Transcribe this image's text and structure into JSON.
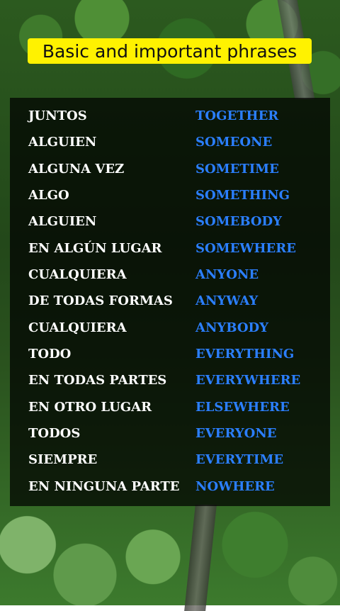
{
  "title": "Basic and important phrases",
  "colors": {
    "title_bg": "#fff200",
    "spanish_text": "#ffffff",
    "english_text": "#2b7fff"
  },
  "phrases": [
    {
      "es": "JUNTOS",
      "en": "TOGETHER"
    },
    {
      "es": "ALGUIEN",
      "en": "SOMEONE"
    },
    {
      "es": "ALGUNA VEZ",
      "en": "SOMETIME"
    },
    {
      "es": "ALGO",
      "en": "SOMETHING"
    },
    {
      "es": "ALGUIEN",
      "en": "SOMEBODY"
    },
    {
      "es": "EN ALGÚN LUGAR",
      "en": "SOMEWHERE"
    },
    {
      "es": "CUALQUIERA",
      "en": "ANYONE"
    },
    {
      "es": "DE TODAS FORMAS",
      "en": "ANYWAY"
    },
    {
      "es": "CUALQUIERA",
      "en": "ANYBODY"
    },
    {
      "es": "TODO",
      "en": "EVERYTHING"
    },
    {
      "es": "EN TODAS PARTES",
      "en": "EVERYWHERE"
    },
    {
      "es": "EN OTRO LUGAR",
      "en": "ELSEWHERE"
    },
    {
      "es": "TODOS",
      "en": "EVERYONE"
    },
    {
      "es": "SIEMPRE",
      "en": "EVERYTIME"
    },
    {
      "es": "EN NINGUNA PARTE",
      "en": "NOWHERE"
    }
  ]
}
